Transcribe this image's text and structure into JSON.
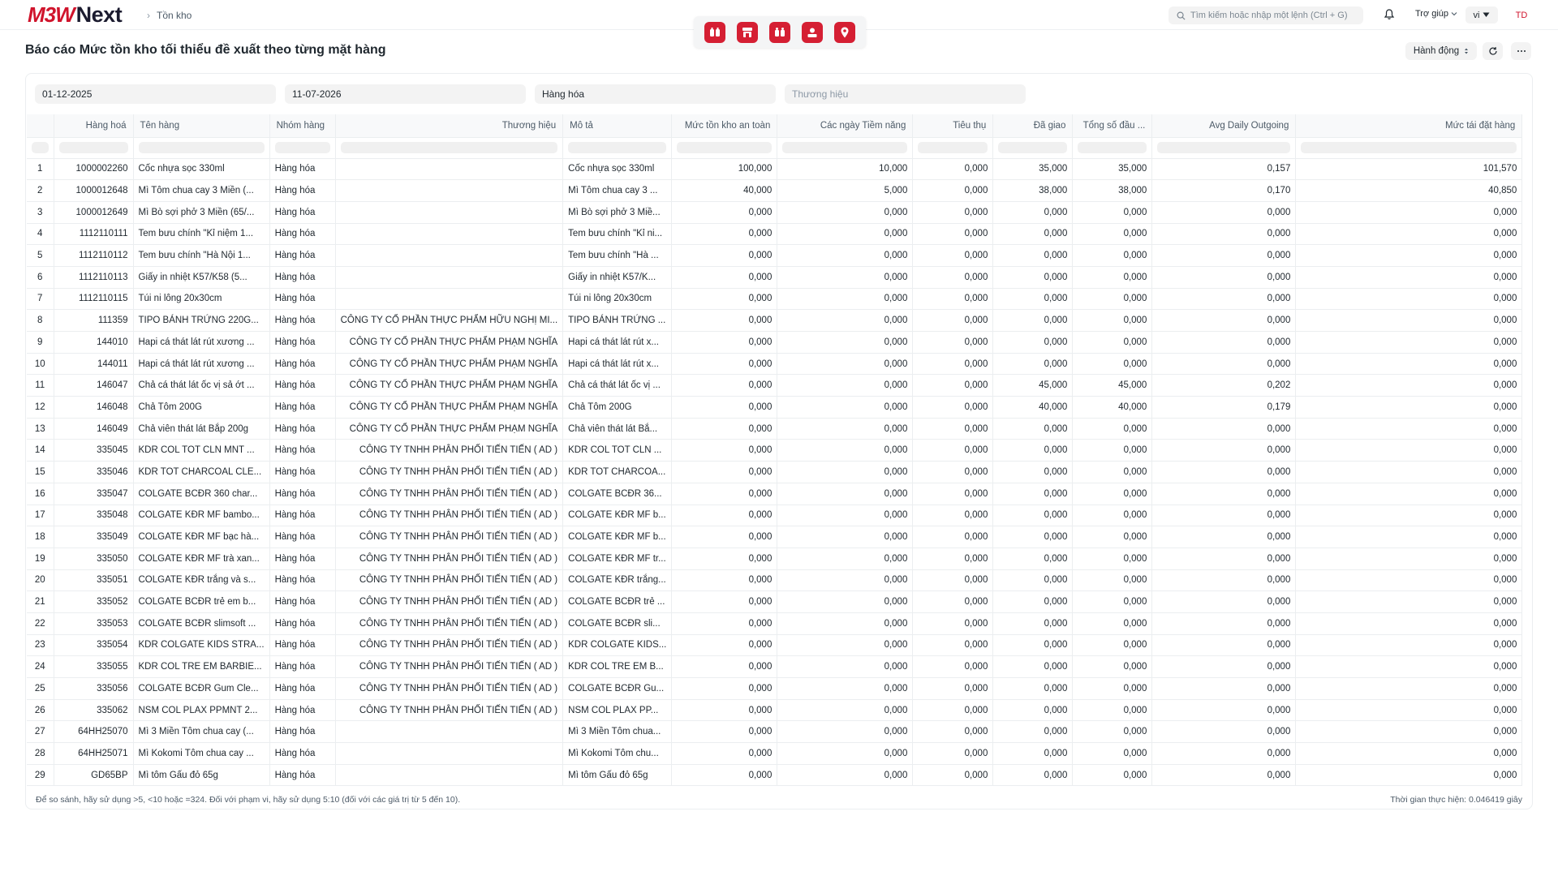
{
  "brand": {
    "mark": "M3W",
    "word": "Next"
  },
  "breadcrumb": {
    "current": "Tồn kho"
  },
  "search": {
    "placeholder": "Tìm kiếm hoặc nhập một lệnh (Ctrl + G)"
  },
  "header": {
    "help_label": "Trợ giúp",
    "lang_label": "vi",
    "avatar_initials": "TD"
  },
  "page": {
    "title": "Báo cáo Mức tồn kho tối thiểu đề xuất theo từng mặt hàng",
    "actions_label": "Hành động"
  },
  "filters": {
    "from_date": "01-12-2025",
    "to_date": "11-07-2026",
    "item_group": "Hàng hóa",
    "brand_placeholder": "Thương hiệu"
  },
  "table": {
    "columns": [
      "Hàng hoá",
      "Tên hàng",
      "Nhóm hàng",
      "Thương hiệu",
      "Mô tả",
      "Mức tồn kho an toàn",
      "Các ngày Tiềm năng",
      "Tiêu thụ",
      "Đã giao",
      "Tổng số đầu ...",
      "Avg Daily Outgoing",
      "Mức tái đặt hàng"
    ],
    "rows": [
      [
        "1",
        "1000002260",
        "Cốc nhựa sọc 330ml",
        "Hàng hóa",
        "",
        "Cốc nhựa sọc 330ml",
        "100,000",
        "10,000",
        "0,000",
        "35,000",
        "35,000",
        "0,157",
        "101,570"
      ],
      [
        "2",
        "1000012648",
        "Mì Tôm chua cay 3 Miền (...",
        "Hàng hóa",
        "",
        "Mì Tôm chua cay 3 ...",
        "40,000",
        "5,000",
        "0,000",
        "38,000",
        "38,000",
        "0,170",
        "40,850"
      ],
      [
        "3",
        "1000012649",
        "Mì Bò sợi phở 3 Miền (65/...",
        "Hàng hóa",
        "",
        "Mì Bò sợi phở 3 Miề...",
        "0,000",
        "0,000",
        "0,000",
        "0,000",
        "0,000",
        "0,000",
        "0,000"
      ],
      [
        "4",
        "1112110111",
        "Tem bưu chính \"Kỉ niệm 1...",
        "Hàng hóa",
        "",
        "Tem bưu chính \"Kỉ ni...",
        "0,000",
        "0,000",
        "0,000",
        "0,000",
        "0,000",
        "0,000",
        "0,000"
      ],
      [
        "5",
        "1112110112",
        "Tem bưu chính \"Hà Nội 1...",
        "Hàng hóa",
        "",
        "Tem bưu chính \"Hà ...",
        "0,000",
        "0,000",
        "0,000",
        "0,000",
        "0,000",
        "0,000",
        "0,000"
      ],
      [
        "6",
        "1112110113",
        "Giấy in nhiệt K57/K58 (5...",
        "Hàng hóa",
        "",
        "Giấy in nhiệt K57/K...",
        "0,000",
        "0,000",
        "0,000",
        "0,000",
        "0,000",
        "0,000",
        "0,000"
      ],
      [
        "7",
        "1112110115",
        "Túi ni lông 20x30cm",
        "Hàng hóa",
        "",
        "Túi ni lông 20x30cm",
        "0,000",
        "0,000",
        "0,000",
        "0,000",
        "0,000",
        "0,000",
        "0,000"
      ],
      [
        "8",
        "111359",
        "TIPO BÁNH TRỨNG 220G...",
        "Hàng hóa",
        "CÔNG TY CỔ PHẦN THỰC PHẨM HỮU NGHỊ MI...",
        "TIPO BÁNH TRỨNG ...",
        "0,000",
        "0,000",
        "0,000",
        "0,000",
        "0,000",
        "0,000",
        "0,000"
      ],
      [
        "9",
        "144010",
        "Hapi cá thát lát rút xương ...",
        "Hàng hóa",
        "CÔNG TY CỔ PHẦN THỰC PHẨM PHẠM NGHĨA",
        "Hapi cá thát lát rút x...",
        "0,000",
        "0,000",
        "0,000",
        "0,000",
        "0,000",
        "0,000",
        "0,000"
      ],
      [
        "10",
        "144011",
        "Hapi cá thát lát rút xương ...",
        "Hàng hóa",
        "CÔNG TY CỔ PHẦN THỰC PHẨM PHẠM NGHĨA",
        "Hapi cá thát lát rút x...",
        "0,000",
        "0,000",
        "0,000",
        "0,000",
        "0,000",
        "0,000",
        "0,000"
      ],
      [
        "11",
        "146047",
        "Chả cá thát lát ốc vị sả ớt ...",
        "Hàng hóa",
        "CÔNG TY CỔ PHẦN THỰC PHẨM PHẠM NGHĨA",
        "Chả cá thát lát ốc vị ...",
        "0,000",
        "0,000",
        "0,000",
        "45,000",
        "45,000",
        "0,202",
        "0,000"
      ],
      [
        "12",
        "146048",
        "Chả Tôm 200G",
        "Hàng hóa",
        "CÔNG TY CỔ PHẦN THỰC PHẨM PHẠM NGHĨA",
        "Chả Tôm 200G",
        "0,000",
        "0,000",
        "0,000",
        "40,000",
        "40,000",
        "0,179",
        "0,000"
      ],
      [
        "13",
        "146049",
        "Chả viên thát lát Bắp 200g",
        "Hàng hóa",
        "CÔNG TY CỔ PHẦN THỰC PHẨM PHẠM NGHĨA",
        "Chả viên thát lát Bắ...",
        "0,000",
        "0,000",
        "0,000",
        "0,000",
        "0,000",
        "0,000",
        "0,000"
      ],
      [
        "14",
        "335045",
        "KDR COL TOT CLN MNT ...",
        "Hàng hóa",
        "CÔNG TY TNHH PHÂN PHỐI TIẾN TIẾN ( AD )",
        "KDR COL TOT CLN ...",
        "0,000",
        "0,000",
        "0,000",
        "0,000",
        "0,000",
        "0,000",
        "0,000"
      ],
      [
        "15",
        "335046",
        "KDR TOT CHARCOAL CLE...",
        "Hàng hóa",
        "CÔNG TY TNHH PHÂN PHỐI TIẾN TIẾN ( AD )",
        "KDR TOT CHARCOA...",
        "0,000",
        "0,000",
        "0,000",
        "0,000",
        "0,000",
        "0,000",
        "0,000"
      ],
      [
        "16",
        "335047",
        "COLGATE BCĐR 360 char...",
        "Hàng hóa",
        "CÔNG TY TNHH PHÂN PHỐI TIẾN TIẾN ( AD )",
        "COLGATE BCĐR 36...",
        "0,000",
        "0,000",
        "0,000",
        "0,000",
        "0,000",
        "0,000",
        "0,000"
      ],
      [
        "17",
        "335048",
        "COLGATE KĐR MF bambo...",
        "Hàng hóa",
        "CÔNG TY TNHH PHÂN PHỐI TIẾN TIẾN ( AD )",
        "COLGATE KĐR MF b...",
        "0,000",
        "0,000",
        "0,000",
        "0,000",
        "0,000",
        "0,000",
        "0,000"
      ],
      [
        "18",
        "335049",
        "COLGATE KĐR MF bạc hà...",
        "Hàng hóa",
        "CÔNG TY TNHH PHÂN PHỐI TIẾN TIẾN ( AD )",
        "COLGATE KĐR MF b...",
        "0,000",
        "0,000",
        "0,000",
        "0,000",
        "0,000",
        "0,000",
        "0,000"
      ],
      [
        "19",
        "335050",
        "COLGATE KĐR MF trà xan...",
        "Hàng hóa",
        "CÔNG TY TNHH PHÂN PHỐI TIẾN TIẾN ( AD )",
        "COLGATE KĐR MF tr...",
        "0,000",
        "0,000",
        "0,000",
        "0,000",
        "0,000",
        "0,000",
        "0,000"
      ],
      [
        "20",
        "335051",
        "COLGATE KĐR trắng và s...",
        "Hàng hóa",
        "CÔNG TY TNHH PHÂN PHỐI TIẾN TIẾN ( AD )",
        "COLGATE KĐR trắng...",
        "0,000",
        "0,000",
        "0,000",
        "0,000",
        "0,000",
        "0,000",
        "0,000"
      ],
      [
        "21",
        "335052",
        "COLGATE BCĐR trẻ em b...",
        "Hàng hóa",
        "CÔNG TY TNHH PHÂN PHỐI TIẾN TIẾN ( AD )",
        "COLGATE BCĐR trẻ ...",
        "0,000",
        "0,000",
        "0,000",
        "0,000",
        "0,000",
        "0,000",
        "0,000"
      ],
      [
        "22",
        "335053",
        "COLGATE BCĐR slimsoft ...",
        "Hàng hóa",
        "CÔNG TY TNHH PHÂN PHỐI TIẾN TIẾN ( AD )",
        "COLGATE BCĐR sli...",
        "0,000",
        "0,000",
        "0,000",
        "0,000",
        "0,000",
        "0,000",
        "0,000"
      ],
      [
        "23",
        "335054",
        "KDR COLGATE KIDS STRA...",
        "Hàng hóa",
        "CÔNG TY TNHH PHÂN PHỐI TIẾN TIẾN ( AD )",
        "KDR COLGATE KIDS...",
        "0,000",
        "0,000",
        "0,000",
        "0,000",
        "0,000",
        "0,000",
        "0,000"
      ],
      [
        "24",
        "335055",
        "KDR COL TRE EM BARBIE...",
        "Hàng hóa",
        "CÔNG TY TNHH PHÂN PHỐI TIẾN TIẾN ( AD )",
        "KDR COL TRE EM B...",
        "0,000",
        "0,000",
        "0,000",
        "0,000",
        "0,000",
        "0,000",
        "0,000"
      ],
      [
        "25",
        "335056",
        "COLGATE BCĐR Gum Cle...",
        "Hàng hóa",
        "CÔNG TY TNHH PHÂN PHỐI TIẾN TIẾN ( AD )",
        "COLGATE BCĐR Gu...",
        "0,000",
        "0,000",
        "0,000",
        "0,000",
        "0,000",
        "0,000",
        "0,000"
      ],
      [
        "26",
        "335062",
        "NSM COL PLAX PPMNT 2...",
        "Hàng hóa",
        "CÔNG TY TNHH PHÂN PHỐI TIẾN TIẾN ( AD )",
        "NSM COL PLAX PP...",
        "0,000",
        "0,000",
        "0,000",
        "0,000",
        "0,000",
        "0,000",
        "0,000"
      ],
      [
        "27",
        "64HH25070",
        "Mì 3 Miền Tôm chua cay (...",
        "Hàng hóa",
        "",
        "Mì 3 Miền Tôm chua...",
        "0,000",
        "0,000",
        "0,000",
        "0,000",
        "0,000",
        "0,000",
        "0,000"
      ],
      [
        "28",
        "64HH25071",
        "Mì Kokomi Tôm chua cay ...",
        "Hàng hóa",
        "",
        "Mì Kokomi Tôm chu...",
        "0,000",
        "0,000",
        "0,000",
        "0,000",
        "0,000",
        "0,000",
        "0,000"
      ],
      [
        "29",
        "GD65BP",
        "Mì tôm Gấu đỏ 65g",
        "Hàng hóa",
        "",
        "Mì tôm Gấu đỏ 65g",
        "0,000",
        "0,000",
        "0,000",
        "0,000",
        "0,000",
        "0,000",
        "0,000"
      ]
    ]
  },
  "footer": {
    "hint": "Để so sánh, hãy sử dụng >5, <10 hoặc =324. Đối với phạm vi, hãy sử dụng 5:10 (đối với các giá trị từ 5 đến 10).",
    "exec_time": "Thời gian thực hiện: 0.046419 giây"
  },
  "colors": {
    "brand_red": "#d0142c",
    "app_icon_red": "#d51f33"
  },
  "icons": [
    "search-icon",
    "bell-icon",
    "chevron-down-icon",
    "refresh-icon",
    "more-icon",
    "caret-updown-icon"
  ]
}
